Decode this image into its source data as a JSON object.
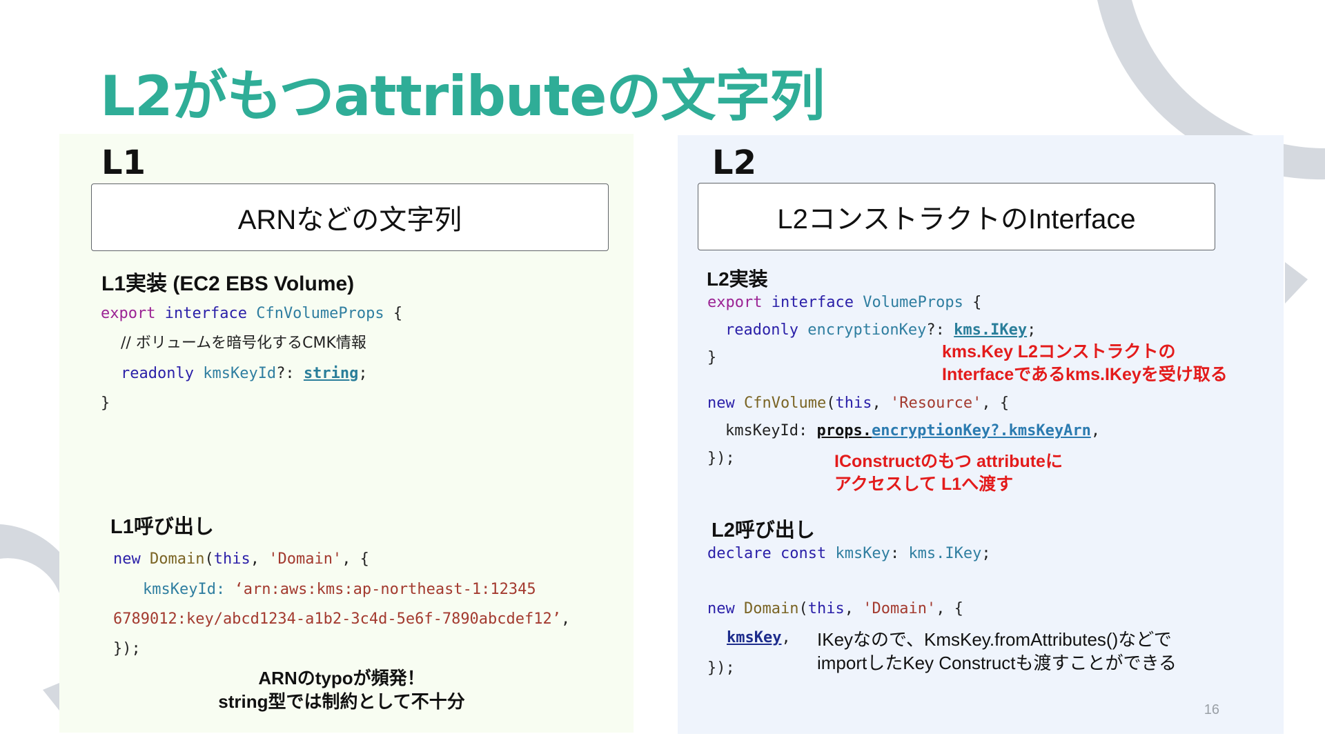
{
  "slide": {
    "title": "L2がもつattributeの文字列",
    "page_number": "16"
  },
  "l1": {
    "heading": "L1",
    "box_label": "ARNなどの文字列",
    "impl_title": "L1実装 (EC2 EBS Volume)",
    "impl_code": {
      "kw_export": "export",
      "kw_interface": "interface",
      "type_name": "CfnVolumeProps",
      "open_brace": "{",
      "comment": "// ボリュームを暗号化するCMK情報",
      "kw_readonly": "readonly",
      "prop_name": "kmsKeyId",
      "optional_colon": "?:",
      "prop_type": "string",
      "semicolon": ";",
      "close_brace": "}"
    },
    "call_title": "L1呼び出し",
    "call_code": {
      "kw_new": "new",
      "class_name": "Domain",
      "kw_this": "this",
      "arg_string": "'Domain'",
      "prop": "kmsKeyId:",
      "arn_part1": "‘arn:aws:kms:ap-northeast-1:12345",
      "arn_part2": "6789012:key/abcd1234-a1b2-3c4d-5e6f-7890abcdef12’",
      "close": "});"
    },
    "note_line1": "ARNのtypoが頻発！",
    "note_line2": "string型では制約として不十分"
  },
  "l2": {
    "heading": "L2",
    "box_label": "L2コンストラクトのInterface",
    "impl_title": "L2実装",
    "impl_code": {
      "kw_export": "export",
      "kw_interface": "interface",
      "type_name": "VolumeProps",
      "open_brace": "{",
      "kw_readonly": "readonly",
      "prop_name": "encryptionKey",
      "optional_colon": "?:",
      "prop_type": "kms.IKey",
      "semicolon": ";",
      "close_brace": "}",
      "kw_new": "new",
      "class_name": "CfnVolume",
      "kw_this": "this",
      "arg_string": "'Resource'",
      "prop2": "kmsKeyId:",
      "props_ref": "props.",
      "key_arn": "encryptionKey?.kmsKeyArn",
      "close": "});"
    },
    "note_interface_line1": "kms.Key L2コンストラクトの",
    "note_interface_line2": "Interfaceであるkms.IKeyを受け取る",
    "note_attr_line1": "IConstructのもつ attributeに",
    "note_attr_line2": "アクセスして L1へ渡す",
    "call_title": "L2呼び出し",
    "call_code": {
      "kw_declare": "declare",
      "kw_const": "const",
      "var_name": "kmsKey",
      "var_type": "kms.IKey",
      "kw_new": "new",
      "class_name": "Domain",
      "kw_this": "this",
      "arg_string": "'Domain'",
      "prop": "kmsKey",
      "close": "});"
    },
    "note_import_line1": "IKeyなので、KmsKey.fromAttributes()などで",
    "note_import_line2": "importしたKey Constructも渡すことができる"
  },
  "colors": {
    "title": "#2fad97",
    "keyword": "#2a1fa8",
    "export_keyword": "#9b2394",
    "type": "#2f7ea0",
    "class": "#7a6424",
    "string": "#a33a2f",
    "note_red": "#e31b1b",
    "panel_l1_bg": "#f8fdf2",
    "panel_l2_bg": "#eff4fc",
    "decor_arc": "#d5d9df"
  }
}
